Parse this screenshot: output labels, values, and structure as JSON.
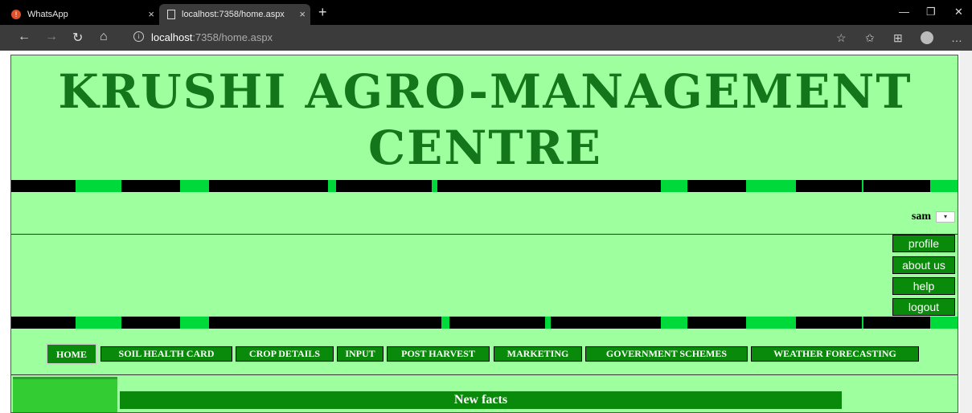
{
  "browser": {
    "tabs": [
      {
        "title": "WhatsApp",
        "icon": "whatsapp-icon"
      },
      {
        "title": "localhost:7358/home.aspx",
        "icon": "page-icon"
      }
    ],
    "url_host": "localhost",
    "url_path": ":7358/home.aspx"
  },
  "site": {
    "title_line1": "KRUSHI AGRO-MANAGEMENT",
    "title_line2": "CENTRE",
    "username": "sam",
    "colors": {
      "background": "#9dff9d",
      "button": "#0a8a0a",
      "title": "#14761a",
      "stripe_accent": "#00d93a"
    }
  },
  "side_menu": {
    "profile": "profile",
    "about": "about us",
    "help": "help",
    "logout": "logout"
  },
  "main_menu": {
    "home": "HOME",
    "soil": "SOIL HEALTH CARD",
    "crop": "CROP DETAILS",
    "input": "INPUT",
    "post": "POST HARVEST",
    "marketing": "MARKETING",
    "gov": "GOVERNMENT SCHEMES",
    "weather": "WEATHER FORECASTING"
  },
  "content": {
    "facts_title": "New facts"
  }
}
